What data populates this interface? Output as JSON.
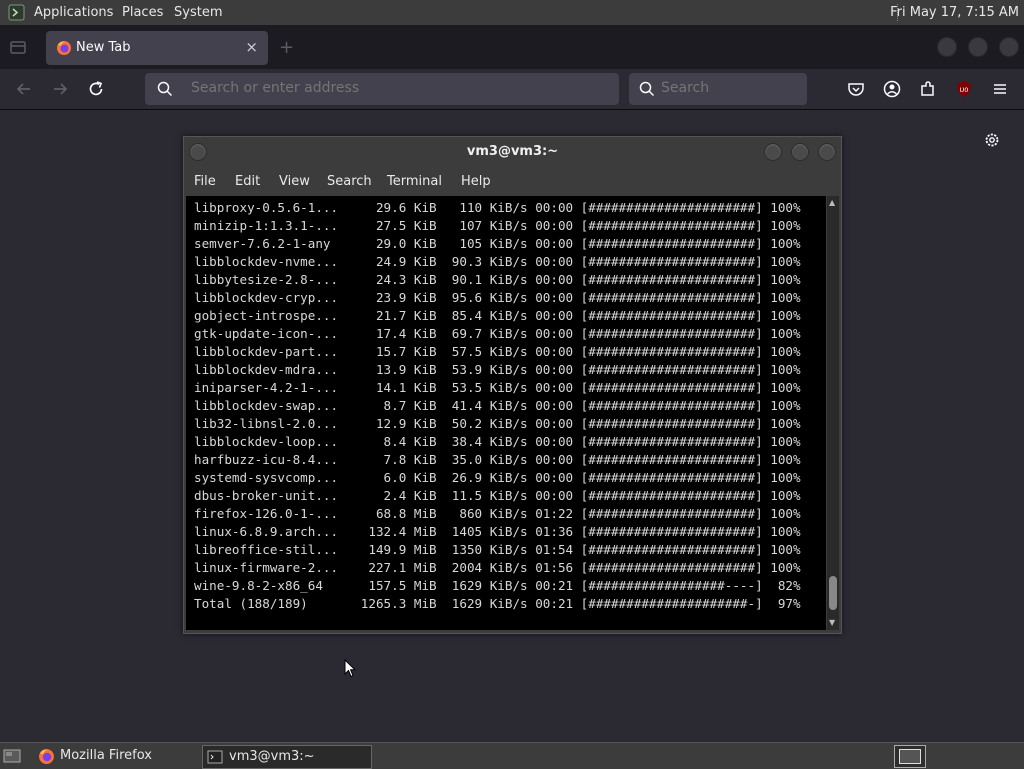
{
  "top_panel": {
    "menus": [
      "Applications",
      "Places",
      "System"
    ],
    "clock": "Fri May 17,  7:15 AM"
  },
  "browser": {
    "tab_title": "New Tab",
    "tab_close": "×",
    "new_tab": "+",
    "url_placeholder": "Search or enter address",
    "search_placeholder": "Search",
    "ublock_badge": "U0"
  },
  "terminal": {
    "title": "vm3@vm3:~",
    "menu": [
      "File",
      "Edit",
      "View",
      "Search",
      "Terminal",
      "Help"
    ],
    "lines": [
      "libproxy-0.5.6-1...     29.6 KiB   110 KiB/s 00:00 [######################] 100%",
      "minizip-1:1.3.1-...     27.5 KiB   107 KiB/s 00:00 [######################] 100%",
      "semver-7.6.2-1-any      29.0 KiB   105 KiB/s 00:00 [######################] 100%",
      "libblockdev-nvme...     24.9 KiB  90.3 KiB/s 00:00 [######################] 100%",
      "libbytesize-2.8-...     24.3 KiB  90.1 KiB/s 00:00 [######################] 100%",
      "libblockdev-cryp...     23.9 KiB  95.6 KiB/s 00:00 [######################] 100%",
      "gobject-introspe...     21.7 KiB  85.4 KiB/s 00:00 [######################] 100%",
      "gtk-update-icon-...     17.4 KiB  69.7 KiB/s 00:00 [######################] 100%",
      "libblockdev-part...     15.7 KiB  57.5 KiB/s 00:00 [######################] 100%",
      "libblockdev-mdra...     13.9 KiB  53.9 KiB/s 00:00 [######################] 100%",
      "iniparser-4.2-1-...     14.1 KiB  53.5 KiB/s 00:00 [######################] 100%",
      "libblockdev-swap...      8.7 KiB  41.4 KiB/s 00:00 [######################] 100%",
      "lib32-libnsl-2.0...     12.9 KiB  50.2 KiB/s 00:00 [######################] 100%",
      "libblockdev-loop...      8.4 KiB  38.4 KiB/s 00:00 [######################] 100%",
      "harfbuzz-icu-8.4...      7.8 KiB  35.0 KiB/s 00:00 [######################] 100%",
      "systemd-sysvcomp...      6.0 KiB  26.9 KiB/s 00:00 [######################] 100%",
      "dbus-broker-unit...      2.4 KiB  11.5 KiB/s 00:00 [######################] 100%",
      "firefox-126.0-1-...     68.8 MiB   860 KiB/s 01:22 [######################] 100%",
      "linux-6.8.9.arch...    132.4 MiB  1405 KiB/s 01:36 [######################] 100%",
      "libreoffice-stil...    149.9 MiB  1350 KiB/s 01:54 [######################] 100%",
      "linux-firmware-2...    227.1 MiB  2004 KiB/s 01:56 [######################] 100%",
      "wine-9.8-2-x86_64      157.5 MiB  1629 KiB/s 00:21 [##################----]  82%",
      "Total (188/189)       1265.3 MiB  1629 KiB/s 00:21 [#####################-]  97%"
    ]
  },
  "taskbar": {
    "items": [
      "Mozilla Firefox",
      "vm3@vm3:~"
    ]
  },
  "colors": {
    "panel": "#3c3c3c",
    "browser_bg": "#2b2a33",
    "terminal_bg": "#000000",
    "terminal_fg": "#d8d8d8"
  }
}
